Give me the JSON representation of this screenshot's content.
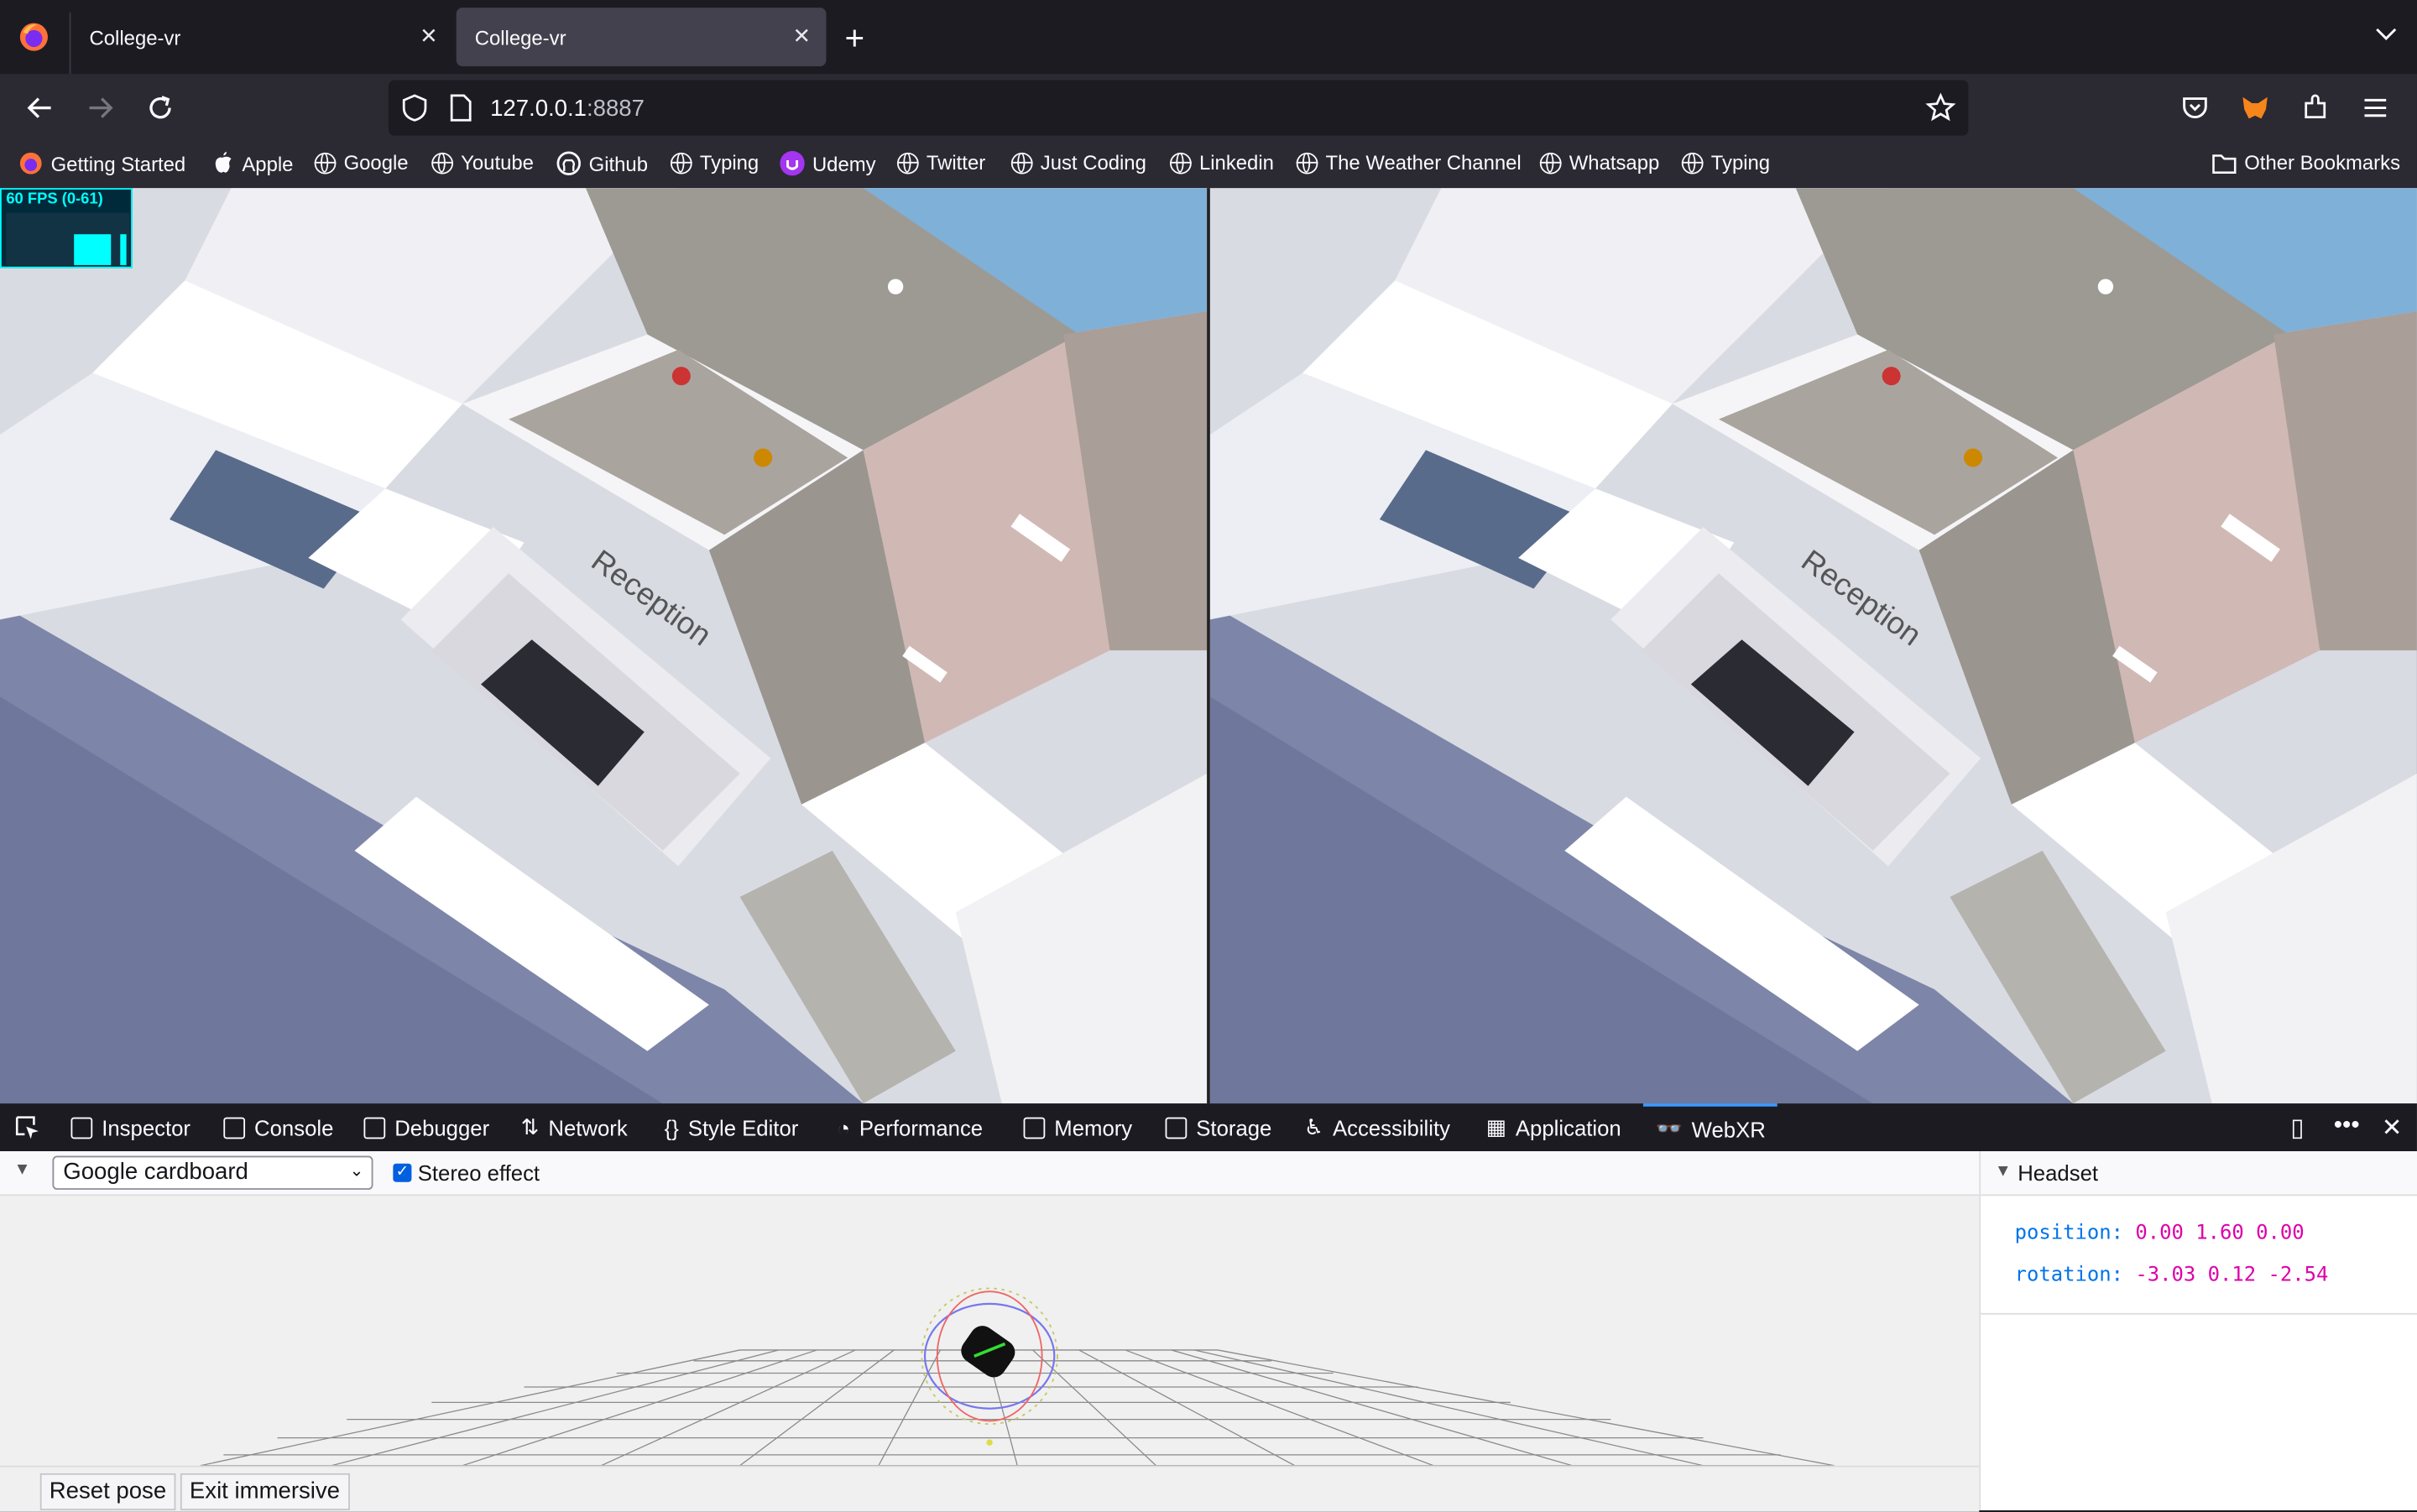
{
  "tabs": [
    {
      "title": "College-vr",
      "active": false
    },
    {
      "title": "College-vr",
      "active": true
    }
  ],
  "address": {
    "host": "127.0.0.1",
    "port": ":8887"
  },
  "bookmarks": [
    {
      "label": "Getting Started",
      "icon": "firefox-icon"
    },
    {
      "label": "Apple",
      "icon": "apple-icon"
    },
    {
      "label": "Google",
      "icon": "globe-icon"
    },
    {
      "label": "Youtube",
      "icon": "globe-icon"
    },
    {
      "label": "Github",
      "icon": "github-icon"
    },
    {
      "label": "Typing",
      "icon": "globe-icon"
    },
    {
      "label": "Udemy",
      "icon": "udemy-icon"
    },
    {
      "label": "Twitter",
      "icon": "globe-icon"
    },
    {
      "label": "Just Coding",
      "icon": "globe-icon"
    },
    {
      "label": "Linkedin",
      "icon": "globe-icon"
    },
    {
      "label": "The Weather Channel",
      "icon": "globe-icon"
    },
    {
      "label": "Whatsapp",
      "icon": "globe-icon"
    },
    {
      "label": "Typing",
      "icon": "globe-icon"
    }
  ],
  "other_bookmarks": "Other Bookmarks",
  "scene": {
    "fps": "60 FPS (0-61)",
    "sign_text": "Reception"
  },
  "devtools": {
    "tabs": [
      {
        "label": "Inspector"
      },
      {
        "label": "Console"
      },
      {
        "label": "Debugger"
      },
      {
        "label": "Network"
      },
      {
        "label": "Style Editor"
      },
      {
        "label": "Performance"
      },
      {
        "label": "Memory"
      },
      {
        "label": "Storage"
      },
      {
        "label": "Accessibility"
      },
      {
        "label": "Application"
      },
      {
        "label": "WebXR"
      }
    ],
    "active_tab": "WebXR"
  },
  "webxr": {
    "device": "Google cardboard",
    "stereo_label": "Stereo effect",
    "stereo_checked": true,
    "reset_pose": "Reset pose",
    "exit_immersive": "Exit immersive",
    "headset_title": "Headset",
    "position_label": "position:",
    "position_value": "0.00 1.60 0.00",
    "rotation_label": "rotation:",
    "rotation_value": "-3.03 0.12 -2.54"
  }
}
